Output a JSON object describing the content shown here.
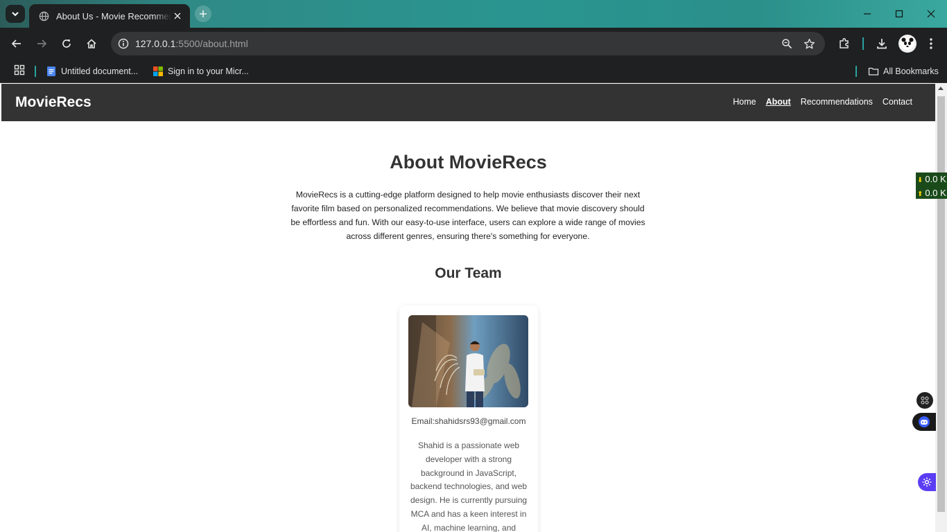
{
  "browser": {
    "tab_title": "About Us - Movie Recommendations",
    "url_host": "127.0.0.1",
    "url_path": ":5500/about.html",
    "bookmarks": [
      {
        "label": "Untitled document..."
      },
      {
        "label": "Sign in to your Micr..."
      }
    ],
    "all_bookmarks": "All Bookmarks"
  },
  "site": {
    "logo": "MovieRecs",
    "nav": [
      {
        "label": "Home"
      },
      {
        "label": "About"
      },
      {
        "label": "Recommendations"
      },
      {
        "label": "Contact"
      }
    ],
    "active_nav": "About"
  },
  "about": {
    "title": "About MovieRecs",
    "text": "MovieRecs is a cutting-edge platform designed to help movie enthusiasts discover their next favorite film based on personalized recommendations. We believe that movie discovery should be effortless and fun. With our easy-to-use interface, users can explore a wide range of movies across different genres, ensuring there's something for everyone."
  },
  "team": {
    "title": "Our Team",
    "members": [
      {
        "email": "Email:shahidsrs93@gmail.com",
        "bio": "Shahid is a passionate web developer with a strong background in JavaScript, backend technologies, and web design. He is currently pursuing MCA and has a keen interest in AI, machine learning, and"
      }
    ]
  },
  "overlay": {
    "download_rate": "0.0 K",
    "upload_rate": "0.0 K"
  },
  "colors": {
    "header_bg": "#333333",
    "accent_teal": "#2ba3a0",
    "widget_purple": "#5b3df5"
  },
  "icons": [
    "tab-search-icon",
    "globe-icon",
    "close-icon",
    "plus-icon",
    "minimize-icon",
    "maximize-icon",
    "back-icon",
    "forward-icon",
    "reload-icon",
    "home-icon",
    "info-icon",
    "zoom-icon",
    "star-icon",
    "extensions-icon",
    "download-icon",
    "menu-dots-icon",
    "apps-grid-icon",
    "docs-icon",
    "microsoft-icon",
    "folder-icon",
    "gear-icon",
    "robot-icon",
    "grid-icon"
  ]
}
